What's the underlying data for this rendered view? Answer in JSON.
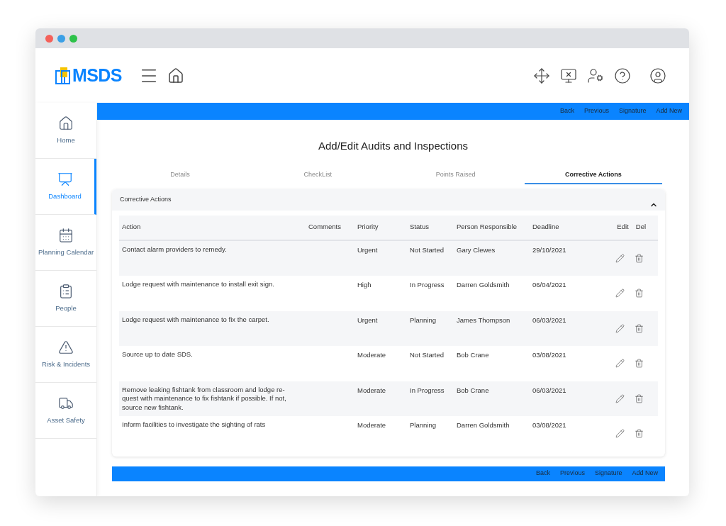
{
  "logo": {
    "text": "MSDS"
  },
  "sidebar": {
    "items": [
      {
        "label": "Home",
        "selected": false
      },
      {
        "label": "Dashboard",
        "selected": true
      },
      {
        "label": "Planning Calendar",
        "selected": false
      },
      {
        "label": "People",
        "selected": false
      },
      {
        "label": "Risk & Incidents",
        "selected": false
      },
      {
        "label": "Asset Safety",
        "selected": false
      }
    ]
  },
  "top_actions": [
    "Back",
    "Previous",
    "Signature",
    "Add New"
  ],
  "page_title": "Add/Edit Audits and Inspections",
  "tabs": [
    {
      "label": "Details",
      "selected": false
    },
    {
      "label": "CheckList",
      "selected": false
    },
    {
      "label": "Points Raised",
      "selected": false
    },
    {
      "label": "Corrective Actions",
      "selected": true
    }
  ],
  "panel": {
    "title": "Corrective Actions",
    "expanded": true
  },
  "table": {
    "columns": [
      "Action",
      "Comments",
      "Priority",
      "Status",
      "Person Responsible",
      "Deadline",
      "Edit",
      "Del"
    ],
    "rows": [
      {
        "action": "Contact alarm providers to remedy.",
        "priority": "Urgent",
        "status": "Not Started",
        "person": "Gary Clewes",
        "deadline": "29/10/2021"
      },
      {
        "action": "Lodge request with maintenance to install exit sign.",
        "priority": "High",
        "status": "In Progress",
        "person": "Darren Goldsmith",
        "deadline": "06/04/2021"
      },
      {
        "action": "Lodge request with maintenance to fix the carpet.",
        "priority": "Urgent",
        "status": "Planning",
        "person": "James Thompson",
        "deadline": "06/03/2021"
      },
      {
        "action": "Source up to date SDS.",
        "priority": "Moderate",
        "status": "Not Started",
        "person": "Bob Crane",
        "deadline": "03/08/2021"
      },
      {
        "action": "Remove leaking fishtank from classroom and lodge re-quest with maintenance to fix fishtank if possible. If not, source new fishtank.",
        "priority": "Moderate",
        "status": "In Progress",
        "person": "Bob Crane",
        "deadline": "06/03/2021"
      },
      {
        "action": "Inform facilities to investigate the sighting of rats",
        "priority": "Moderate",
        "status": "Planning",
        "person": "Darren Goldsmith",
        "deadline": "03/08/2021"
      }
    ]
  },
  "bottom_actions": [
    "Back",
    "Previous",
    "Signature",
    "Add New"
  ]
}
